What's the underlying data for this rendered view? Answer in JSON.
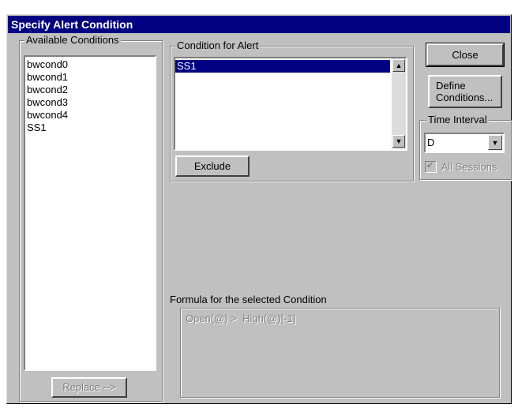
{
  "dialog": {
    "title": "Specify Alert Condition"
  },
  "available": {
    "label": "Available Conditions",
    "items": [
      "bwcond0",
      "bwcond1",
      "bwcond2",
      "bwcond3",
      "bwcond4",
      "SS1"
    ],
    "replace_label": "Replace -->"
  },
  "alert": {
    "label": "Condition for Alert",
    "items": [
      "SS1"
    ],
    "exclude_label": "Exclude"
  },
  "buttons": {
    "close_label": "Close",
    "define_line1": "Define",
    "define_line2": "Conditions..."
  },
  "time_interval": {
    "label": "Time Interval",
    "value": "D",
    "all_sessions_label": "All Sessions",
    "all_sessions_checked": true
  },
  "formula": {
    "label": "Formula for the selected Condition",
    "text": "Open(@) >  High(@)[-1]"
  },
  "icons": {
    "scroll_up": "▲",
    "scroll_down": "▼",
    "dropdown": "▼",
    "check": "✔"
  }
}
